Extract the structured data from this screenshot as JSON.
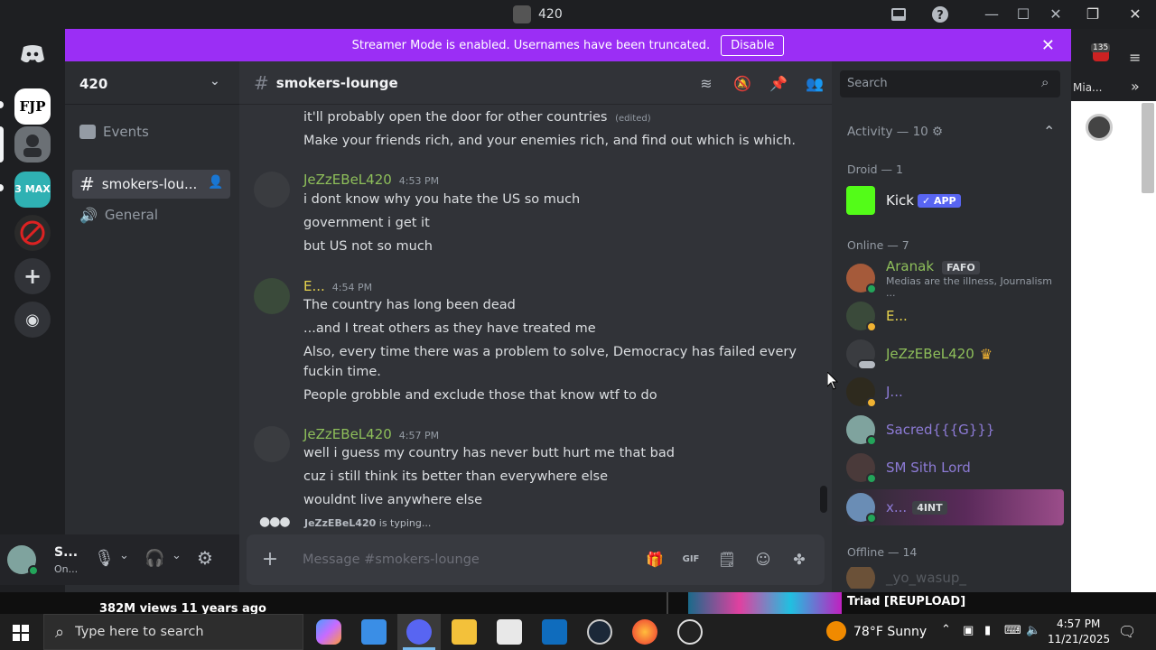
{
  "window": {
    "title": "420"
  },
  "banner": {
    "text": "Streamer Mode is enabled. Usernames have been truncated.",
    "button": "Disable"
  },
  "servers": [
    {
      "name": "FJP"
    },
    {
      "name": "3 MAX"
    }
  ],
  "sidebar": {
    "server_name": "420",
    "channels": [
      {
        "label": "Events"
      },
      {
        "label": "smokers-lou..."
      },
      {
        "label": "General"
      }
    ]
  },
  "user": {
    "name": "S...",
    "status": "On..."
  },
  "chat": {
    "channel": "smokers-lounge",
    "messages": [
      {
        "text": "it'll probably open the door for other countries",
        "edited": "(edited)"
      },
      {
        "text": "Make your friends rich, and your enemies rich, and find out which is which."
      },
      {
        "author": "JeZzEBeL420",
        "time": "4:53 PM",
        "lines": [
          "i dont know why you hate the US so much",
          "government i get it",
          "but US not so much"
        ]
      },
      {
        "author": "E...",
        "time": "4:54 PM",
        "lines": [
          "The country has long been dead",
          "...and I treat others as they have treated me",
          "Also, every time there was a problem to solve, Democracy has failed every",
          "fuckin time.",
          "People grobble and exclude those that know wtf to do"
        ]
      },
      {
        "author": "JeZzEBeL420",
        "time": "4:57 PM",
        "lines": [
          "well i guess my country has never butt hurt me that bad",
          "cuz i still think its better than everywhere else",
          "wouldnt  live anywhere else"
        ]
      }
    ],
    "typing_user": "JeZzEBeL420",
    "typing_suffix": " is typing...",
    "composer_placeholder": "Message #smokers-lounge"
  },
  "members": {
    "search_placeholder": "Search",
    "activity_header": "Activity — 10",
    "droid_header": "Droid — 1",
    "droid": {
      "name": "Kick",
      "tag": "✓ APP"
    },
    "online_header": "Online — 7",
    "online": [
      {
        "name": "Aranak",
        "tag": "FAFO",
        "sub": "Medias are the illness, Journalism ...",
        "color": "#8ebf5a"
      },
      {
        "name": "E...",
        "color": "#e8d44d"
      },
      {
        "name": "JeZzEBeL420",
        "color": "#8ebf5a"
      },
      {
        "name": "J...",
        "color": "#8d7bd6"
      },
      {
        "name": "Sacred{{{G}}}",
        "color": "#8d7bd6"
      },
      {
        "name": "SM Sith Lord",
        "color": "#8d7bd6"
      },
      {
        "name": "x...",
        "tag": "4INT",
        "color": "#8d7bd6"
      }
    ],
    "offline_header": "Offline — 14",
    "offline": [
      {
        "name": "_yo_wasup_"
      }
    ]
  },
  "background": {
    "browser_tab": "Mia...",
    "notif_count": "135",
    "video_views": "382M views  11 years ago",
    "video_title": "Triad [REUPLOAD]"
  },
  "taskbar": {
    "search_placeholder": "Type here to search",
    "weather": "78°F  Sunny",
    "time": "4:57 PM",
    "date": "11/21/2025"
  },
  "colors": {
    "accent": "#9b2ef5",
    "green_name": "#8ebf5a",
    "yellow_name": "#e8d44d",
    "purple_name": "#8d7bd6"
  }
}
